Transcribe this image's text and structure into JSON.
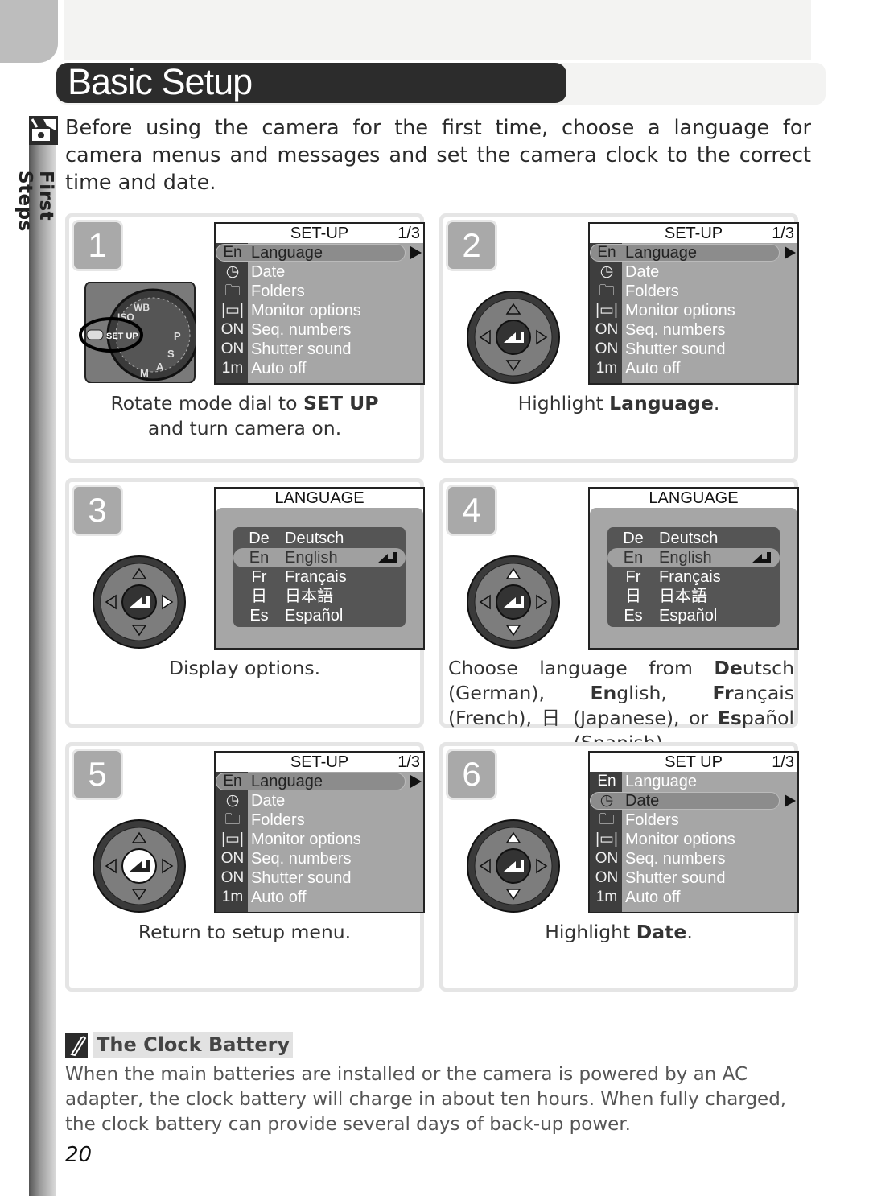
{
  "page": {
    "side_label": "First Steps",
    "title": "Basic Setup",
    "intro": "Before using the camera for the first time, choose a language for camera menus and messages and set the camera clock to the correct time and date.",
    "page_number": "20"
  },
  "setup_menu": {
    "title_1": "SET-UP",
    "title_2": "SET UP",
    "page": "1/3",
    "items": [
      {
        "icon": "En",
        "label": "Language"
      },
      {
        "icon": "clock",
        "label": "Date"
      },
      {
        "icon": "folder",
        "label": "Folders"
      },
      {
        "icon": "|▭|",
        "label": "Monitor options"
      },
      {
        "icon": "ON",
        "label": "Seq. numbers"
      },
      {
        "icon": "ON",
        "label": "Shutter sound"
      },
      {
        "icon": "1m",
        "label": "Auto off"
      }
    ]
  },
  "language_menu": {
    "title": "LANGUAGE",
    "options": [
      {
        "code": "De",
        "name": "Deutsch"
      },
      {
        "code": "En",
        "name": "English"
      },
      {
        "code": "Fr",
        "name": "Français"
      },
      {
        "code": "日",
        "name": "日本語"
      },
      {
        "code": "Es",
        "name": "Español"
      }
    ],
    "selected": "English"
  },
  "dial": {
    "label": "SET UP"
  },
  "steps": [
    {
      "number": "1",
      "caption_pre": "Rotate mode dial to ",
      "caption_bold": "SET UP",
      "caption_post": "and turn camera on."
    },
    {
      "number": "2",
      "caption_pre": "Highlight ",
      "caption_bold": "Language",
      "caption_post": "."
    },
    {
      "number": "3",
      "caption": "Display options."
    },
    {
      "number": "4",
      "caption_parts": [
        "Choose language from ",
        "De",
        "utsch (German), ",
        "En",
        "glish, ",
        "Fr",
        "ançais (French), ",
        "日",
        " (Japanese), or ",
        "Es",
        "pañol (Spanish)."
      ]
    },
    {
      "number": "5",
      "caption": "Return to setup menu."
    },
    {
      "number": "6",
      "caption_pre": "Highlight ",
      "caption_bold": "Date",
      "caption_post": "."
    }
  ],
  "note": {
    "title": "The Clock Battery",
    "body": "When the main batteries are installed or the camera is powered by an AC adapter, the clock battery will charge in about ten hours.  When fully charged, the clock battery can provide several days of back-up power."
  }
}
